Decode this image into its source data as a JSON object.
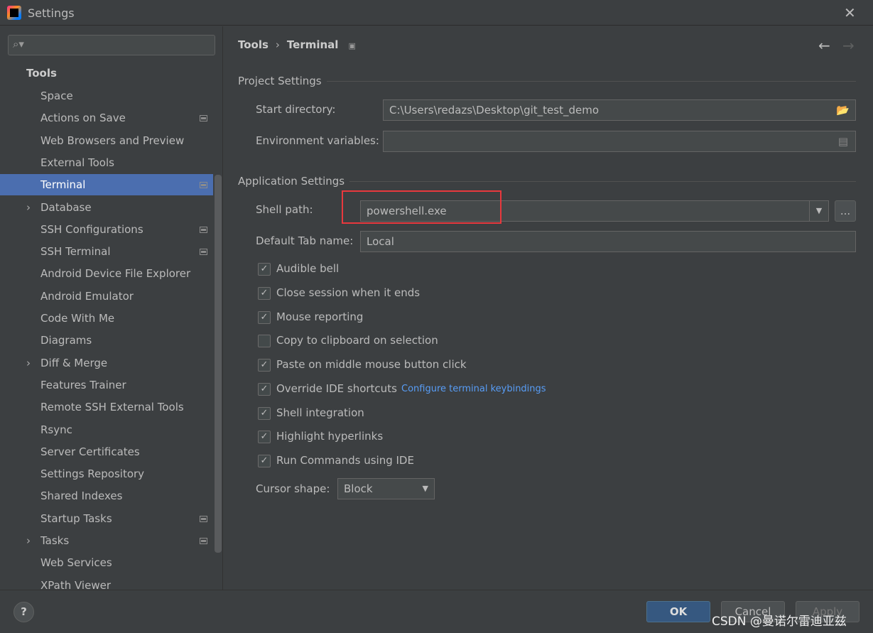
{
  "window": {
    "title": "Settings",
    "close_icon": "close-icon"
  },
  "sidebar": {
    "search_placeholder": "",
    "section": "Tools",
    "items": [
      {
        "label": "Space",
        "expandable": false,
        "marker": false
      },
      {
        "label": "Actions on Save",
        "expandable": false,
        "marker": true
      },
      {
        "label": "Web Browsers and Preview",
        "expandable": false,
        "marker": false
      },
      {
        "label": "External Tools",
        "expandable": false,
        "marker": false
      },
      {
        "label": "Terminal",
        "expandable": false,
        "marker": true,
        "selected": true
      },
      {
        "label": "Database",
        "expandable": true,
        "marker": false
      },
      {
        "label": "SSH Configurations",
        "expandable": false,
        "marker": true
      },
      {
        "label": "SSH Terminal",
        "expandable": false,
        "marker": true
      },
      {
        "label": "Android Device File Explorer",
        "expandable": false,
        "marker": false
      },
      {
        "label": "Android Emulator",
        "expandable": false,
        "marker": false
      },
      {
        "label": "Code With Me",
        "expandable": false,
        "marker": false
      },
      {
        "label": "Diagrams",
        "expandable": false,
        "marker": false
      },
      {
        "label": "Diff & Merge",
        "expandable": true,
        "marker": false
      },
      {
        "label": "Features Trainer",
        "expandable": false,
        "marker": false
      },
      {
        "label": "Remote SSH External Tools",
        "expandable": false,
        "marker": false
      },
      {
        "label": "Rsync",
        "expandable": false,
        "marker": false
      },
      {
        "label": "Server Certificates",
        "expandable": false,
        "marker": false
      },
      {
        "label": "Settings Repository",
        "expandable": false,
        "marker": false
      },
      {
        "label": "Shared Indexes",
        "expandable": false,
        "marker": false
      },
      {
        "label": "Startup Tasks",
        "expandable": false,
        "marker": true
      },
      {
        "label": "Tasks",
        "expandable": true,
        "marker": true
      },
      {
        "label": "Web Services",
        "expandable": false,
        "marker": false
      },
      {
        "label": "XPath Viewer",
        "expandable": false,
        "marker": false
      }
    ]
  },
  "breadcrumb": {
    "parent": "Tools",
    "sep": "›",
    "current": "Terminal"
  },
  "project": {
    "title": "Project Settings",
    "start_dir_label": "Start directory:",
    "start_dir": "C:\\Users\\redazs\\Desktop\\git_test_demo",
    "env_label": "Environment variables:",
    "env_value": ""
  },
  "app": {
    "title": "Application Settings",
    "shell_label": "Shell path:",
    "shell": "powershell.exe",
    "browse": "...",
    "tab_label": "Default Tab name:",
    "tab": "Local",
    "checkboxes": [
      {
        "label": "Audible bell",
        "checked": true
      },
      {
        "label": "Close session when it ends",
        "checked": true
      },
      {
        "label": "Mouse reporting",
        "checked": true
      },
      {
        "label": "Copy to clipboard on selection",
        "checked": false
      },
      {
        "label": "Paste on middle mouse button click",
        "checked": true
      },
      {
        "label": "Override IDE shortcuts",
        "checked": true
      },
      {
        "label": "Shell integration",
        "checked": true
      },
      {
        "label": "Highlight hyperlinks",
        "checked": true
      },
      {
        "label": "Run Commands using IDE",
        "checked": true
      }
    ],
    "link": "Configure terminal keybindings",
    "cursor_label": "Cursor shape:",
    "cursor": "Block"
  },
  "footer": {
    "help": "?",
    "ok": "OK",
    "cancel": "Cancel",
    "apply": "Apply"
  },
  "watermark": "CSDN @曼诺尔雷迪亚兹",
  "colors": {
    "selection": "#4b6eaf",
    "highlight_box": "#e8383d",
    "link": "#589df6"
  }
}
